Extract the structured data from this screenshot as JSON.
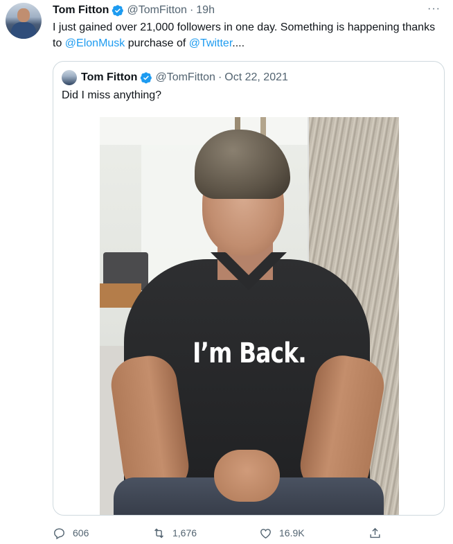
{
  "tweet": {
    "author_name": "Tom Fitton",
    "author_handle": "@TomFitton",
    "separator": "·",
    "time": "19h",
    "more": "···",
    "text_part1": "I just gained over 21,000 followers in one day. Something is happening thanks to ",
    "mention1": "@ElonMusk",
    "text_part2": " purchase of ",
    "mention2": "@Twitter",
    "text_part3": "...."
  },
  "quoted": {
    "author_name": "Tom Fitton",
    "author_handle": "@TomFitton",
    "separator": "·",
    "date": "Oct 22, 2021",
    "text": "Did I miss anything?",
    "image_caption": "I’m Back."
  },
  "actions": {
    "replies": "606",
    "retweets": "1,676",
    "likes": "16.9K"
  },
  "colors": {
    "accent": "#1d9bf0",
    "secondary_text": "#536471",
    "border": "#cfd9de"
  },
  "icons": [
    "verified-badge-icon",
    "more-icon",
    "reply-icon",
    "retweet-icon",
    "like-icon",
    "share-icon"
  ]
}
